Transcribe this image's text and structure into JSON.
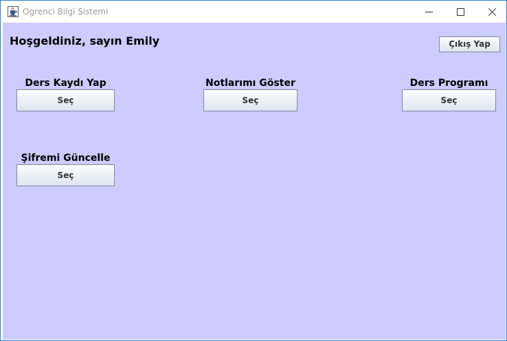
{
  "window": {
    "title": "Ogrenci Bilgi Sistemi",
    "icon": "java-cup-icon"
  },
  "colors": {
    "background": "#ccccff",
    "border": "#2b7fd4"
  },
  "header": {
    "welcome": "Hoşgeldiniz, sayın Emily",
    "logout_label": "Çıkış Yap"
  },
  "modules": [
    {
      "label": "Ders Kaydı Yap",
      "button": "Seç"
    },
    {
      "label": "Notlarımı Göster",
      "button": "Seç"
    },
    {
      "label": "Ders Programı",
      "button": "Seç"
    },
    {
      "label": "Şifremi Güncelle",
      "button": "Seç"
    }
  ]
}
